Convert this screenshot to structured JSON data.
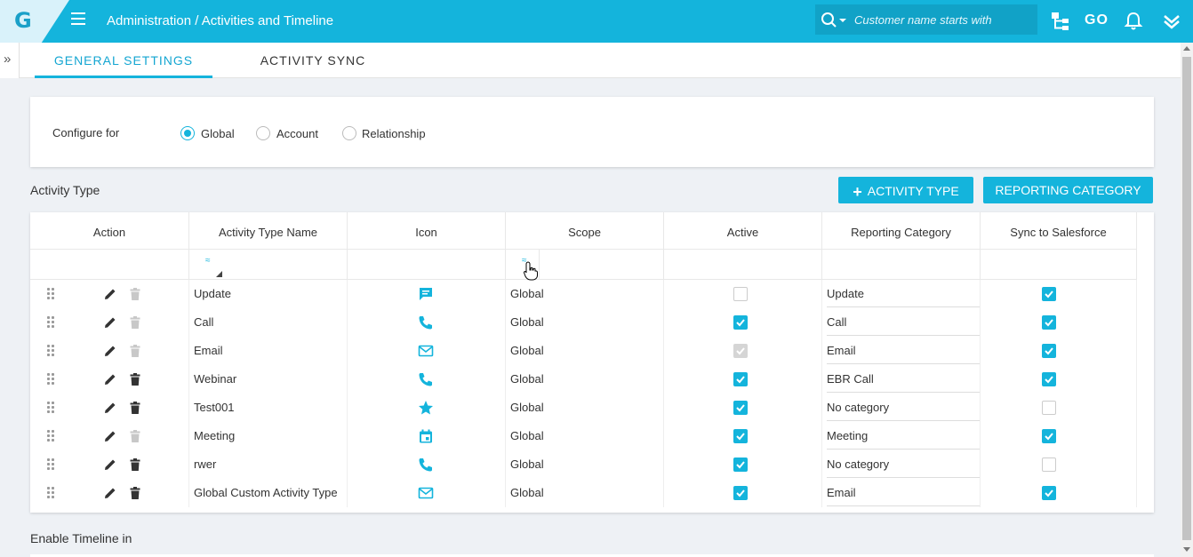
{
  "header": {
    "logo": "G",
    "title": "Administration / Activities and Timeline",
    "search_placeholder": "Customer name starts with",
    "go_label": "GO"
  },
  "tabs": [
    {
      "label": "GENERAL SETTINGS",
      "active": true
    },
    {
      "label": "ACTIVITY SYNC",
      "active": false
    }
  ],
  "config": {
    "label": "Configure for",
    "options": [
      {
        "label": "Global",
        "checked": true
      },
      {
        "label": "Account",
        "checked": false
      },
      {
        "label": "Relationship",
        "checked": false
      }
    ]
  },
  "activity_section": {
    "title": "Activity Type",
    "add_button": "ACTIVITY TYPE",
    "reporting_button": "REPORTING CATEGORY"
  },
  "table": {
    "columns": [
      "Action",
      "Activity Type Name",
      "Icon",
      "Scope",
      "Active",
      "Reporting Category",
      "Sync to Salesforce"
    ],
    "rows": [
      {
        "name": "Update",
        "icon": "message-icon",
        "scope": "Global",
        "active": "off",
        "category": "Update",
        "sync": "on",
        "can_delete": false
      },
      {
        "name": "Call",
        "icon": "phone-icon",
        "scope": "Global",
        "active": "on",
        "category": "Call",
        "sync": "on",
        "can_delete": false
      },
      {
        "name": "Email",
        "icon": "mail-icon",
        "scope": "Global",
        "active": "on-disabled",
        "category": "Email",
        "sync": "on",
        "can_delete": false
      },
      {
        "name": "Webinar",
        "icon": "phone-icon",
        "scope": "Global",
        "active": "on",
        "category": "EBR Call",
        "sync": "on",
        "can_delete": true
      },
      {
        "name": "Test001",
        "icon": "star-icon",
        "scope": "Global",
        "active": "on",
        "category": "No category",
        "sync": "off",
        "can_delete": true
      },
      {
        "name": "Meeting",
        "icon": "calendar-icon",
        "scope": "Global",
        "active": "on",
        "category": "Meeting",
        "sync": "on",
        "can_delete": false
      },
      {
        "name": "rwer",
        "icon": "phone-icon",
        "scope": "Global",
        "active": "on",
        "category": "No category",
        "sync": "off",
        "can_delete": true
      },
      {
        "name": "Global Custom Activity Type",
        "icon": "mail-icon",
        "scope": "Global",
        "active": "on",
        "category": "Email",
        "sync": "on",
        "can_delete": true
      }
    ]
  },
  "timeline_section": {
    "title": "Enable Timeline in"
  },
  "colors": {
    "accent": "#14b4dc",
    "header_bg": "#14b4dc"
  }
}
